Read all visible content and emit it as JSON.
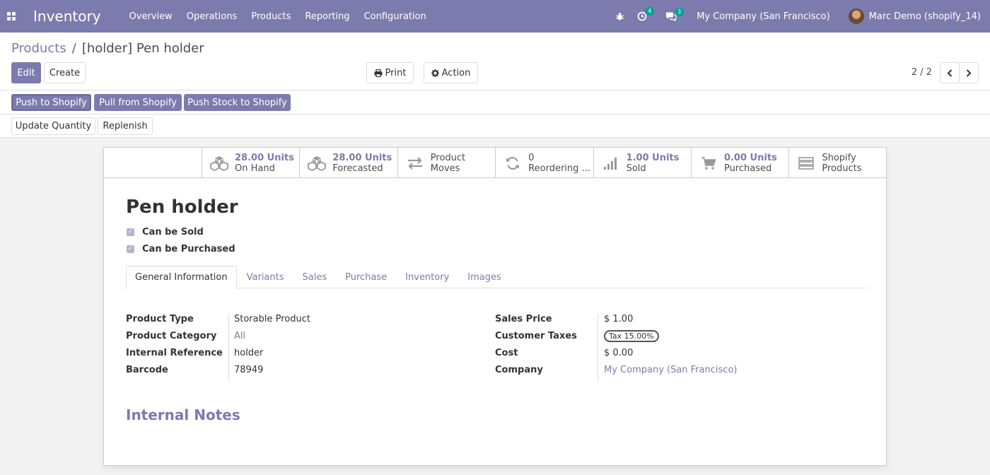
{
  "navbar": {
    "app_name": "Inventory",
    "menu": [
      "Overview",
      "Operations",
      "Products",
      "Reporting",
      "Configuration"
    ],
    "activity_count": "4",
    "message_count": "3",
    "company": "My Company (San Francisco)",
    "user": "Marc Demo (shopify_14)"
  },
  "breadcrumb": {
    "parent": "Products",
    "separator": "/",
    "current": "[holder] Pen holder"
  },
  "toolbar": {
    "edit": "Edit",
    "create": "Create",
    "print": "Print",
    "action": "Action",
    "pager": "2 / 2"
  },
  "shopify_buttons": [
    "Push to Shopify",
    "Pull from Shopify",
    "Push Stock to Shopify"
  ],
  "header_buttons": [
    "Update Quantity",
    "Replenish"
  ],
  "stat_buttons": [
    {
      "value": "28.00 Units",
      "label": "On Hand",
      "icon": "cubes-icon"
    },
    {
      "value": "28.00 Units",
      "label": "Forecasted",
      "icon": "cubes-icon"
    },
    {
      "value": "Product",
      "label": "Moves",
      "icon": "exchange-icon"
    },
    {
      "value": "0",
      "label": "Reordering ...",
      "icon": "refresh-icon"
    },
    {
      "value": "1.00 Units",
      "label": "Sold",
      "icon": "signal-icon"
    },
    {
      "value": "0.00 Units",
      "label": "Purchased",
      "icon": "cart-icon"
    },
    {
      "value": "Shopify",
      "label": "Products",
      "icon": "list-icon"
    }
  ],
  "product": {
    "name": "Pen holder",
    "can_be_sold": "Can be Sold",
    "can_be_purchased": "Can be Purchased"
  },
  "tabs": [
    "General Information",
    "Variants",
    "Sales",
    "Purchase",
    "Inventory",
    "Images"
  ],
  "left_fields": [
    {
      "label": "Product Type",
      "value": "Storable Product"
    },
    {
      "label": "Product Category",
      "value": "All"
    },
    {
      "label": "Internal Reference",
      "value": "holder"
    },
    {
      "label": "Barcode",
      "value": "78949"
    }
  ],
  "right_fields": [
    {
      "label": "Sales Price",
      "value": "$ 1.00"
    },
    {
      "label": "Customer Taxes",
      "value": "Tax 15.00%"
    },
    {
      "label": "Cost",
      "value": "$ 0.00"
    },
    {
      "label": "Company",
      "value": "My Company (San Francisco)"
    }
  ],
  "notes_title": "Internal Notes",
  "colors": {
    "brand": "#7c7bad",
    "badge": "#00a09d"
  }
}
